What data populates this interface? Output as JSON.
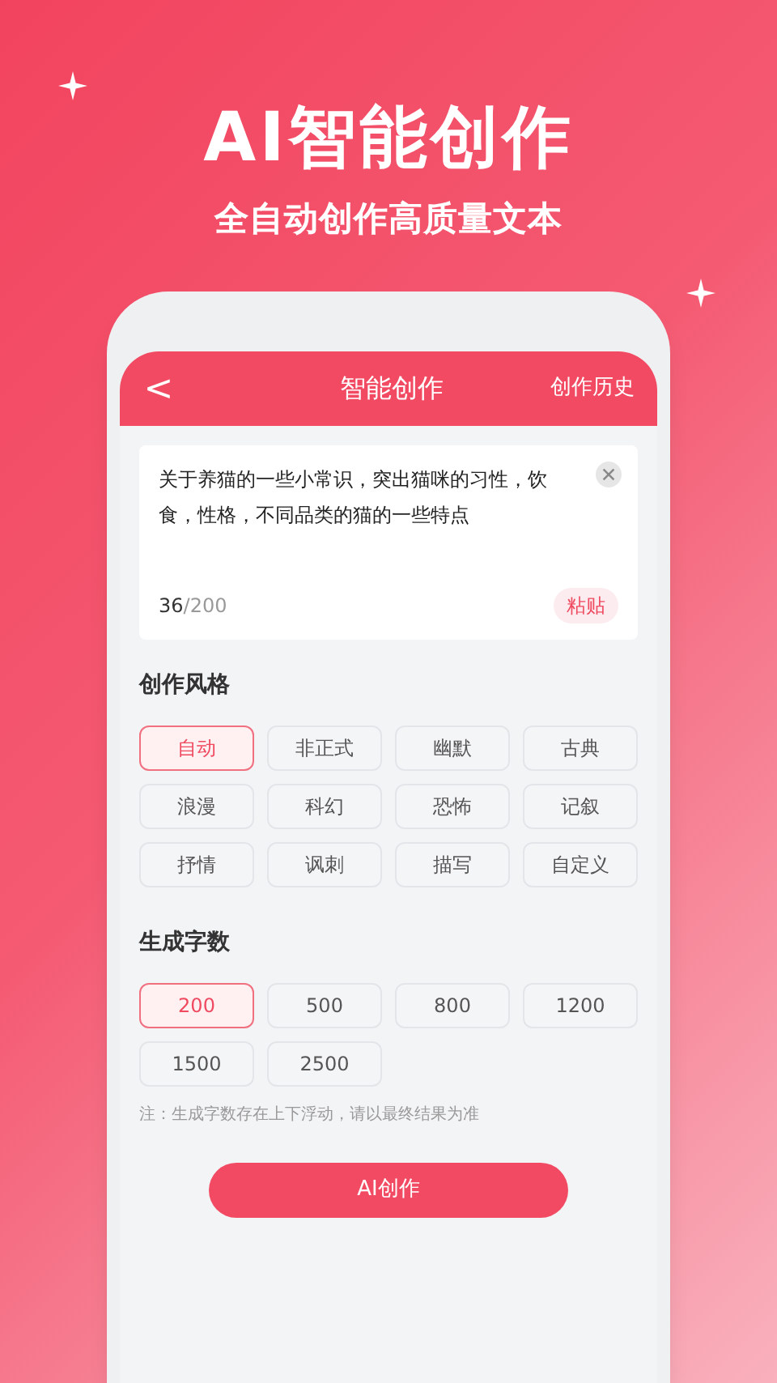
{
  "promo": {
    "title": "AI智能创作",
    "subtitle": "全自动创作高质量文本"
  },
  "app_bar": {
    "back": "<",
    "title": "智能创作",
    "action": "创作历史"
  },
  "input": {
    "value": "关于养猫的一些小常识，突出猫咪的习性，饮食，性格，不同品类的猫的一些特点",
    "count": "36",
    "max": "/200",
    "paste": "粘贴"
  },
  "style_section": {
    "title": "创作风格",
    "options": [
      {
        "label": "自动",
        "selected": true
      },
      {
        "label": "非正式",
        "selected": false
      },
      {
        "label": "幽默",
        "selected": false
      },
      {
        "label": "古典",
        "selected": false
      },
      {
        "label": "浪漫",
        "selected": false
      },
      {
        "label": "科幻",
        "selected": false
      },
      {
        "label": "恐怖",
        "selected": false
      },
      {
        "label": "记叙",
        "selected": false
      },
      {
        "label": "抒情",
        "selected": false
      },
      {
        "label": "讽刺",
        "selected": false
      },
      {
        "label": "描写",
        "selected": false
      },
      {
        "label": "自定义",
        "selected": false
      }
    ]
  },
  "length_section": {
    "title": "生成字数",
    "options": [
      {
        "label": "200",
        "selected": true
      },
      {
        "label": "500",
        "selected": false
      },
      {
        "label": "800",
        "selected": false
      },
      {
        "label": "1200",
        "selected": false
      },
      {
        "label": "1500",
        "selected": false
      },
      {
        "label": "2500",
        "selected": false
      }
    ],
    "note": "注：生成字数存在上下浮动，请以最终结果为准"
  },
  "submit": "AI创作"
}
